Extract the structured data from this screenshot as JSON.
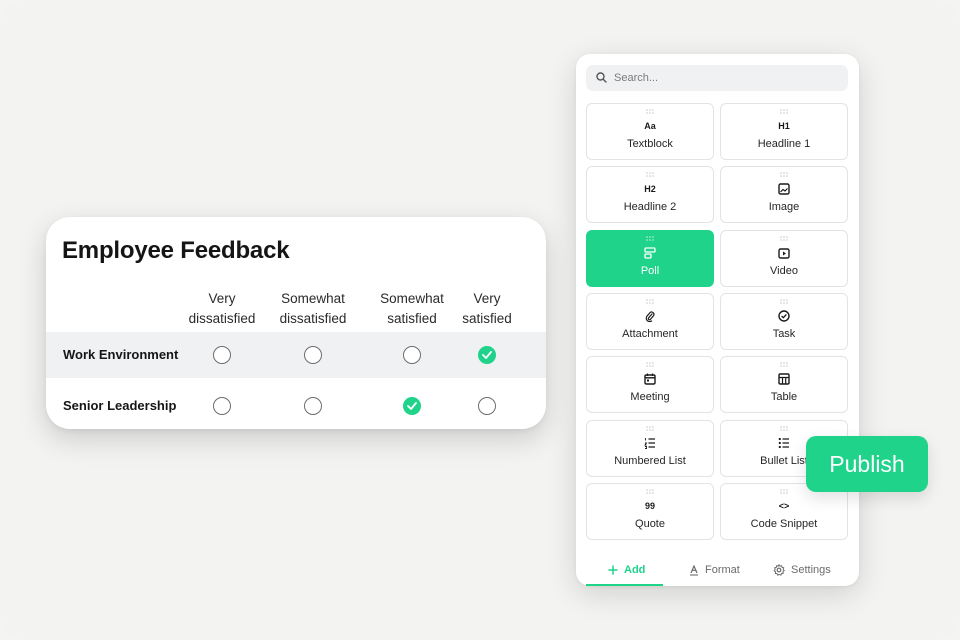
{
  "survey": {
    "title": "Employee Feedback",
    "columns": [
      {
        "line1": "Very",
        "line2": "dissatisfied"
      },
      {
        "line1": "Somewhat",
        "line2": "dissatisfied"
      },
      {
        "line1": "Somewhat",
        "line2": "satisfied"
      },
      {
        "line1": "Very",
        "line2": "satisfied"
      }
    ],
    "rows": [
      {
        "label": "Work Environment",
        "selected": "Very satisfied"
      },
      {
        "label": "Senior Leadership",
        "selected": "Somewhat satisfied"
      }
    ]
  },
  "panel": {
    "search_placeholder": "Search...",
    "tiles": [
      {
        "label": "Textblock",
        "icon": "text-aa-icon",
        "glyph": "Aa"
      },
      {
        "label": "Headline 1",
        "icon": "h1-icon",
        "glyph": "H1"
      },
      {
        "label": "Headline 2",
        "icon": "h2-icon",
        "glyph": "H2"
      },
      {
        "label": "Image",
        "icon": "image-icon"
      },
      {
        "label": "Poll",
        "icon": "poll-icon"
      },
      {
        "label": "Video",
        "icon": "video-icon"
      },
      {
        "label": "Attachment",
        "icon": "paperclip-icon"
      },
      {
        "label": "Task",
        "icon": "check-circle-icon"
      },
      {
        "label": "Meeting",
        "icon": "calendar-icon"
      },
      {
        "label": "Table",
        "icon": "table-icon"
      },
      {
        "label": "Numbered List",
        "icon": "numbered-list-icon"
      },
      {
        "label": "Bullet List",
        "icon": "bullet-list-icon"
      },
      {
        "label": "Quote",
        "icon": "quote-icon",
        "glyph": "99"
      },
      {
        "label": "Code Snippet",
        "icon": "code-icon",
        "glyph": "<>"
      }
    ],
    "active_tile": "Poll",
    "tabs": [
      {
        "label": "Add",
        "icon": "plus-icon"
      },
      {
        "label": "Format",
        "icon": "text-format-icon"
      },
      {
        "label": "Settings",
        "icon": "gear-icon"
      }
    ],
    "active_tab": "Add"
  },
  "publish_label": "Publish",
  "colors": {
    "accent": "#1fd38a",
    "background": "#f3f3f1"
  }
}
